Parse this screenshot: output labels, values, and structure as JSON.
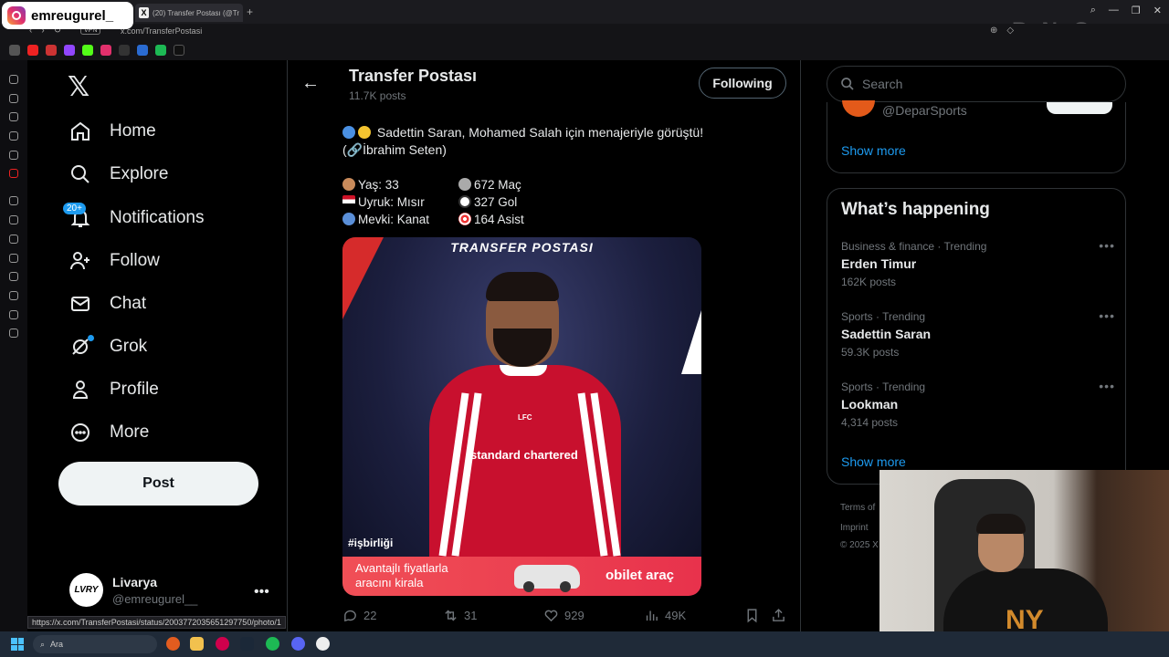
{
  "browser": {
    "tab_title": "(20) Transfer Postası (@Tr",
    "url": "x.com/TransferPostasi",
    "vpn": "VPN",
    "status_url": "https://x.com/TransferPostasi/status/2003772035651297750/photo/1"
  },
  "overlay": {
    "instagram_handle": "emreugurel_"
  },
  "nav": {
    "items": [
      {
        "label": "Home",
        "icon": "home-icon"
      },
      {
        "label": "Explore",
        "icon": "search-icon"
      },
      {
        "label": "Notifications",
        "icon": "bell-icon"
      },
      {
        "label": "Follow",
        "icon": "person-plus-icon"
      },
      {
        "label": "Chat",
        "icon": "mail-icon"
      },
      {
        "label": "Grok",
        "icon": "grok-icon"
      },
      {
        "label": "Profile",
        "icon": "person-icon"
      },
      {
        "label": "More",
        "icon": "more-circle-icon"
      }
    ],
    "notifications_badge": "20+",
    "post_label": "Post"
  },
  "account": {
    "name": "Livarya",
    "handle": "@emreugurel__",
    "avatar_text": "LVRY"
  },
  "header": {
    "title": "Transfer Postası",
    "posts_count": "11.7K posts",
    "following_label": "Following"
  },
  "tweet": {
    "line1": "Sadettin Saran, Mohamed Salah için menajeriyle görüştü!",
    "line2": "(🔗İbrahim Seten)",
    "stats_left": [
      "Yaş: 33",
      "Uyruk: Mısır",
      "Mevki: Kanat"
    ],
    "stats_right": [
      "672 Maç",
      "327 Gol",
      "164 Asist"
    ],
    "media": {
      "title": "TRANSFER POSTASI",
      "hashtag": "#işbirliği",
      "ad_line1": "Avantajlı fiyatlarla",
      "ad_line2": "aracını kirala",
      "ad_brand": "obilet araç",
      "sponsor": "standard chartered",
      "crest": "LFC"
    },
    "actions": {
      "replies": "22",
      "reposts": "31",
      "likes": "929",
      "views": "49K"
    }
  },
  "right": {
    "search_placeholder": "Search",
    "who_to_follow_handle": "@DeparSports",
    "show_more_1": "Show more",
    "trends_title": "What’s happening",
    "trends": [
      {
        "category": "Business & finance · Trending",
        "name": "Erden Timur",
        "count": "162K posts"
      },
      {
        "category": "Sports · Trending",
        "name": "Sadettin Saran",
        "count": "59.3K posts"
      },
      {
        "category": "Sports · Trending",
        "name": "Lookman",
        "count": "4,314 posts"
      }
    ],
    "show_more_2": "Show more",
    "footer": [
      "Terms of",
      "Imprint",
      "© 2025 X"
    ]
  },
  "taskbar": {
    "search_label": "Ara"
  },
  "colors": {
    "accent": "#1d9bf0",
    "background": "#000000",
    "text": "#e7e9ea",
    "muted": "#71767b"
  }
}
